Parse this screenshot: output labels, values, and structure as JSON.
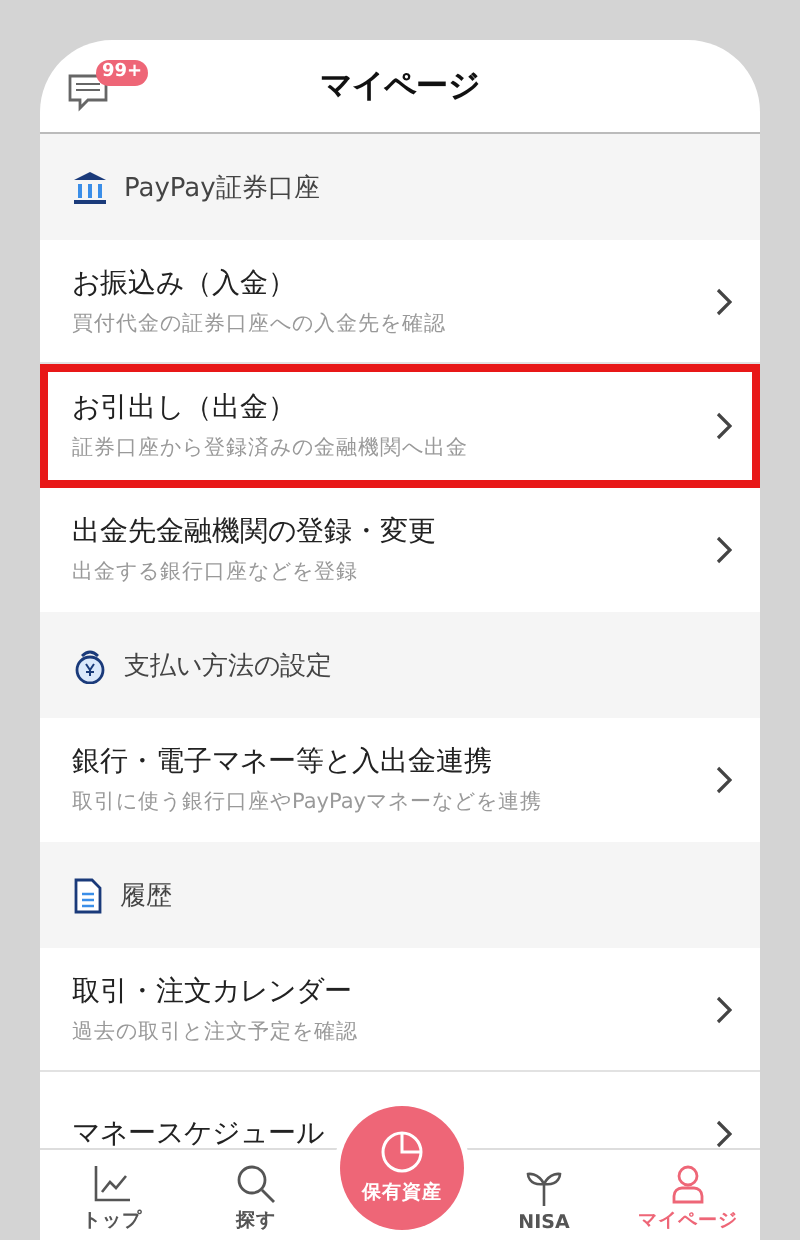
{
  "header": {
    "title": "マイページ",
    "badge": "99+"
  },
  "sections": [
    {
      "kind": "bank",
      "title": "PayPay証券口座",
      "rows": [
        {
          "title": "お振込み（入金）",
          "subtitle": "買付代金の証券口座への入金先を確認",
          "highlighted": false
        },
        {
          "title": "お引出し（出金）",
          "subtitle": "証券口座から登録済みの金融機関へ出金",
          "highlighted": true
        },
        {
          "title": "出金先金融機関の登録・変更",
          "subtitle": "出金する銀行口座などを登録",
          "highlighted": false
        }
      ]
    },
    {
      "kind": "wallet",
      "title": "支払い方法の設定",
      "rows": [
        {
          "title": "銀行・電子マネー等と入出金連携",
          "subtitle": "取引に使う銀行口座やPayPayマネーなどを連携",
          "highlighted": false
        }
      ]
    },
    {
      "kind": "document",
      "title": "履歴",
      "rows": [
        {
          "title": "取引・注文カレンダー",
          "subtitle": "過去の取引と注文予定を確認",
          "highlighted": false
        },
        {
          "title": "マネースケジュール",
          "highlighted": false
        }
      ]
    }
  ],
  "tab_bar": [
    {
      "kind": "chart",
      "label": "トップ",
      "selected": false
    },
    {
      "kind": "search",
      "label": "探す",
      "selected": false
    },
    {
      "kind": "center",
      "label": "保有資産",
      "selected": false
    },
    {
      "kind": "sprout",
      "label": "NISA",
      "selected": false
    },
    {
      "kind": "person",
      "label": "マイページ",
      "selected": true
    }
  ]
}
